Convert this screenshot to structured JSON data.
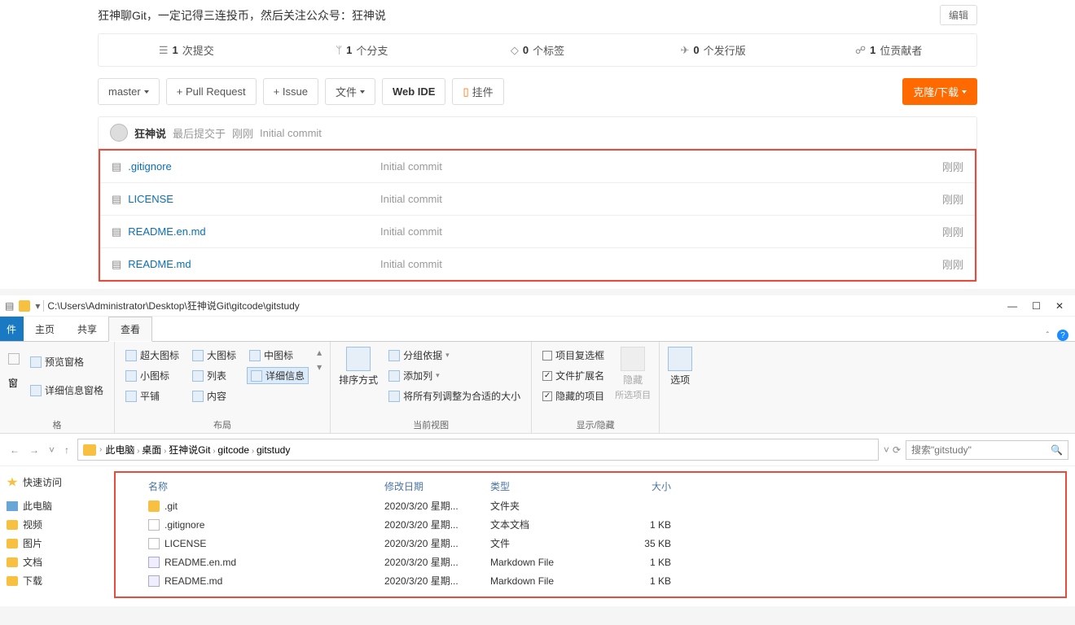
{
  "gitee": {
    "description": "狂神聊Git，一定记得三连投币，然后关注公众号：狂神说",
    "edit_label": "编辑",
    "stats": {
      "commits_n": "1",
      "commits_l": "次提交",
      "branches_n": "1",
      "branches_l": "个分支",
      "tags_n": "0",
      "tags_l": "个标签",
      "releases_n": "0",
      "releases_l": "个发行版",
      "contribs_n": "1",
      "contribs_l": "位贡献者"
    },
    "toolbar": {
      "branch": "master",
      "pull_request": "+ Pull Request",
      "issue": "+ Issue",
      "files": "文件",
      "web_ide": "Web IDE",
      "attachment": "挂件",
      "clone": "克隆/下载"
    },
    "last_commit": {
      "user": "狂神说",
      "meta": "最后提交于",
      "when": "刚刚",
      "msg": "Initial commit"
    },
    "files": [
      {
        "name": ".gitignore",
        "msg": "Initial commit",
        "time": "刚刚"
      },
      {
        "name": "LICENSE",
        "msg": "Initial commit",
        "time": "刚刚"
      },
      {
        "name": "README.en.md",
        "msg": "Initial commit",
        "time": "刚刚"
      },
      {
        "name": "README.md",
        "msg": "Initial commit",
        "time": "刚刚"
      }
    ]
  },
  "explorer": {
    "titlebar_path": "C:\\Users\\Administrator\\Desktop\\狂神说Git\\gitcode\\gitstudy",
    "tabs": {
      "file": "件",
      "home": "主页",
      "share": "共享",
      "view": "查看"
    },
    "ribbon": {
      "panes": {
        "preview": "预览窗格",
        "details": "详细信息窗格",
        "panes_label_prefix": "窗",
        "panes_label_suffix": "格"
      },
      "layout": {
        "xl": "超大图标",
        "lg": "大图标",
        "md": "中图标",
        "sm": "小图标",
        "list": "列表",
        "details": "详细信息",
        "tiles": "平铺",
        "content": "内容",
        "label": "布局"
      },
      "curview": {
        "sort": "排序方式",
        "groupby": "分组依据",
        "addcol": "添加列",
        "autosize": "将所有列调整为合适的大小",
        "label": "当前视图"
      },
      "showhide": {
        "itemcb": "项目复选框",
        "ext": "文件扩展名",
        "hidden": "隐藏的项目",
        "hide": "隐藏",
        "hide2": "所选项目",
        "label": "显示/隐藏"
      },
      "options": "选项"
    },
    "nav": {
      "crumbs": [
        "此电脑",
        "桌面",
        "狂神说Git",
        "gitcode",
        "gitstudy"
      ],
      "search_placeholder": "搜索\"gitstudy\""
    },
    "sidebar": {
      "quick": "快速访问",
      "pc": "此电脑",
      "videos": "视频",
      "pictures": "图片",
      "docs": "文档",
      "downloads": "下载"
    },
    "list": {
      "headers": {
        "name": "名称",
        "date": "修改日期",
        "type": "类型",
        "size": "大小"
      },
      "rows": [
        {
          "ico": "folder",
          "name": ".git",
          "date": "2020/3/20 星期...",
          "type": "文件夹",
          "size": ""
        },
        {
          "ico": "txt",
          "name": ".gitignore",
          "date": "2020/3/20 星期...",
          "type": "文本文档",
          "size": "1 KB"
        },
        {
          "ico": "file",
          "name": "LICENSE",
          "date": "2020/3/20 星期...",
          "type": "文件",
          "size": "35 KB"
        },
        {
          "ico": "md",
          "name": "README.en.md",
          "date": "2020/3/20 星期...",
          "type": "Markdown File",
          "size": "1 KB"
        },
        {
          "ico": "md",
          "name": "README.md",
          "date": "2020/3/20 星期...",
          "type": "Markdown File",
          "size": "1 KB"
        }
      ]
    }
  }
}
